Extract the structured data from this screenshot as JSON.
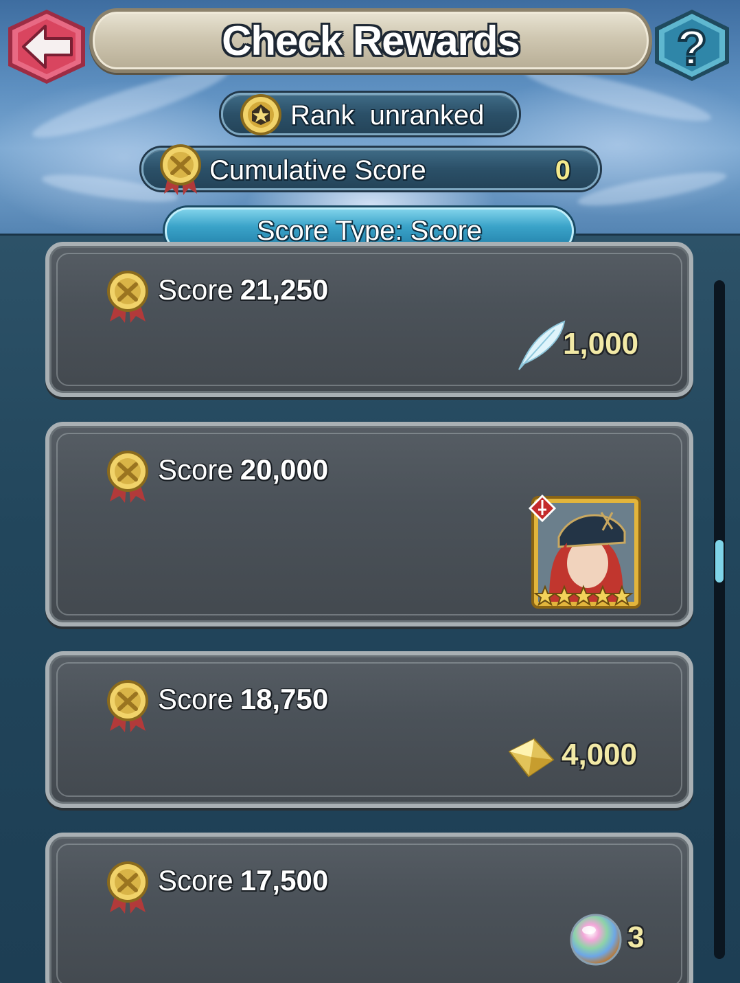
{
  "header": {
    "title": "Check Rewards",
    "back_icon": "back-arrow-icon",
    "help_icon": "help-question-icon"
  },
  "rank": {
    "label": "Rank",
    "value": "unranked"
  },
  "cumulative": {
    "label": "Cumulative Score",
    "value": "0"
  },
  "score_type": {
    "label": "Score Type: Score"
  },
  "rewards": [
    {
      "label": "Score",
      "score": "21,250",
      "reward_icon": "feather-icon",
      "amount": "1,000"
    },
    {
      "label": "Score",
      "score": "20,000",
      "reward_icon": "hero-portrait-icon",
      "amount": ""
    },
    {
      "label": "Score",
      "score": "18,750",
      "reward_icon": "crystal-icon",
      "amount": "4,000"
    },
    {
      "label": "Score",
      "score": "17,500",
      "reward_icon": "orb-icon",
      "amount": "3"
    }
  ],
  "colors": {
    "accent": "#3aa3c9",
    "gold_text": "#f2e9a6",
    "back_button": "#e0506a"
  }
}
